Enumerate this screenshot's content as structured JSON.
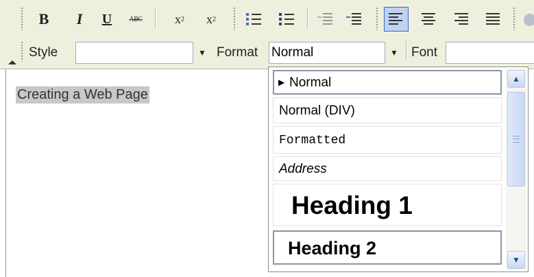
{
  "toolbar": {
    "bold": "B",
    "italic": "I",
    "underline": "U",
    "strike": "ABC",
    "subscript_base": "x",
    "subscript_mark": "2",
    "superscript_base": "x",
    "superscript_mark": "2",
    "style_label": "Style",
    "style_value": "",
    "format_label": "Format",
    "format_value": "Normal",
    "font_label": "Font",
    "font_value": "",
    "dropdown_arrow": "▼",
    "active_button": "justify-left",
    "active_color": "#c1d2ee"
  },
  "editor": {
    "content": "Creating a Web Page"
  },
  "format_dropdown": {
    "items": [
      {
        "label": "Normal",
        "marker": "▶"
      },
      {
        "label": "Normal (DIV)"
      },
      {
        "label": "Formatted"
      },
      {
        "label": "Address"
      },
      {
        "label": "Heading 1"
      },
      {
        "label": "Heading 2"
      }
    ],
    "scroll_up": "▲",
    "scroll_down": "▼"
  }
}
